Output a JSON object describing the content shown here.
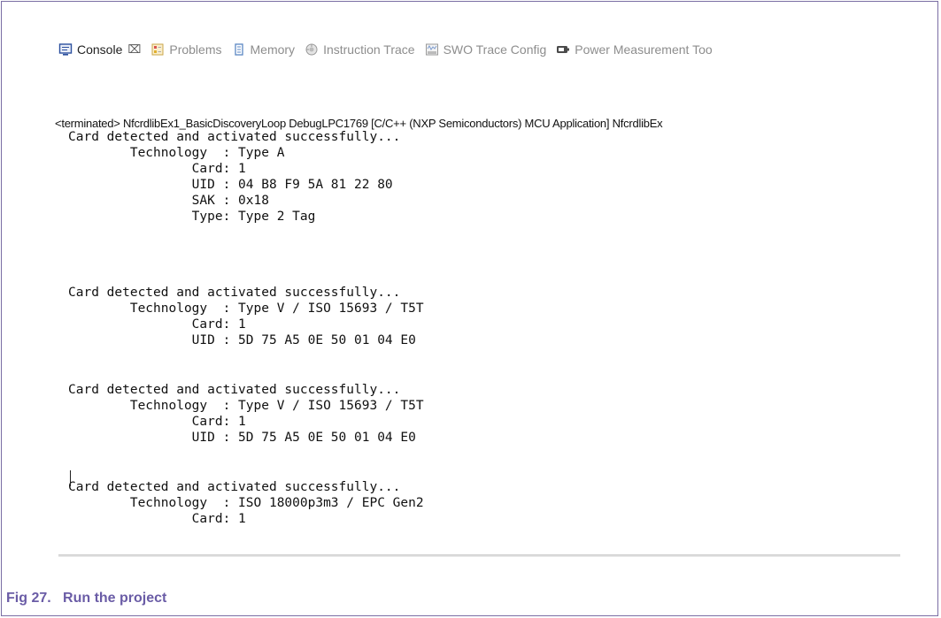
{
  "tabs": [
    {
      "id": "console",
      "label": "Console",
      "icon": "console-icon",
      "active": true,
      "close": "⌧"
    },
    {
      "id": "problems",
      "label": "Problems",
      "icon": "problems-icon"
    },
    {
      "id": "memory",
      "label": "Memory",
      "icon": "memory-icon"
    },
    {
      "id": "instruction-trace",
      "label": "Instruction Trace",
      "icon": "instruction-trace-icon"
    },
    {
      "id": "swo-trace-config",
      "label": "SWO Trace Config",
      "icon": "swo-icon"
    },
    {
      "id": "power-measurement",
      "label": "Power Measurement Too",
      "icon": "power-icon"
    }
  ],
  "console": {
    "status": "<terminated> NfcrdlibEx1_BasicDiscoveryLoop DebugLPC1769 [C/C++ (NXP Semiconductors) MCU Application] NfcrdlibEx",
    "lines": [
      "Card detected and activated successfully...",
      "        Technology  : Type A",
      "                Card: 1",
      "                UID : 04 B8 F9 5A 81 22 80",
      "                SAK : 0x18",
      "                Type: Type 2 Tag",
      "",
      "Card detected and activated successfully...",
      "        Technology  : Type V / ISO 15693 / T5T",
      "                Card: 1",
      "                UID : 5D 75 A5 0E 50 01 04 E0",
      "",
      "Card detected and activated successfully...",
      "        Technology  : Type V / ISO 15693 / T5T",
      "                Card: 1",
      "                UID : 5D 75 A5 0E 50 01 04 E0",
      "",
      "Card detected and activated successfully...",
      "        Technology  : ISO 18000p3m3 / EPC Gen2",
      "                Card: 1"
    ]
  },
  "caption": "Fig 27.   Run the project",
  "colors": {
    "caption": "#6a5ca6",
    "frame": "#7a6ea4"
  }
}
